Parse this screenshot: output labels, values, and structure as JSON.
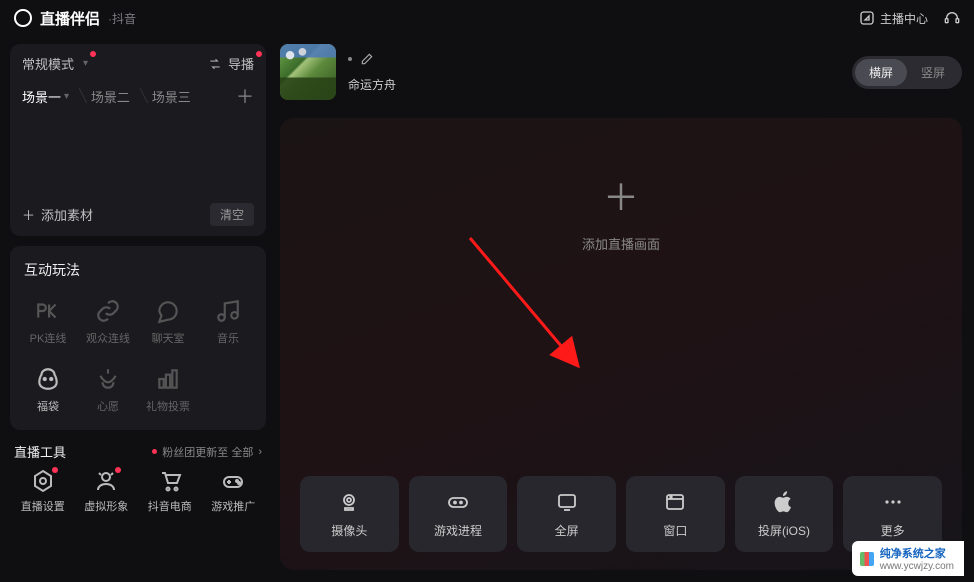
{
  "header": {
    "app_title": "直播伴侣",
    "sub_title": "·抖音",
    "host_center": "主播中心"
  },
  "sidebar": {
    "mode_label": "常规模式",
    "director_label": "导播",
    "scenes": [
      "场景一",
      "场景二",
      "场景三"
    ],
    "add_material": "添加素材",
    "clear": "清空",
    "interact_title": "互动玩法",
    "interact_items": [
      {
        "name": "pk",
        "label": "PK连线"
      },
      {
        "name": "audience",
        "label": "观众连线"
      },
      {
        "name": "chat",
        "label": "聊天室"
      },
      {
        "name": "music",
        "label": "音乐"
      },
      {
        "name": "lucky",
        "label": "福袋"
      },
      {
        "name": "wish",
        "label": "心愿"
      },
      {
        "name": "giftvote",
        "label": "礼物投票"
      }
    ],
    "tools_title": "直播工具",
    "tools_sub": "粉丝团更新至 全部",
    "tool_items": [
      {
        "name": "settings",
        "label": "直播设置",
        "dot": true
      },
      {
        "name": "avatar",
        "label": "虚拟形象",
        "dot": true
      },
      {
        "name": "ecom",
        "label": "抖音电商",
        "dot": false
      },
      {
        "name": "gamepromo",
        "label": "游戏推广",
        "dot": false
      }
    ]
  },
  "content": {
    "stream_title": "命运方舟",
    "orient_h": "横屏",
    "orient_v": "竖屏",
    "add_canvas": "添加直播画面",
    "sources": [
      {
        "name": "camera",
        "label": "摄像头"
      },
      {
        "name": "game",
        "label": "游戏进程"
      },
      {
        "name": "fullscreen",
        "label": "全屏"
      },
      {
        "name": "window",
        "label": "窗口"
      },
      {
        "name": "ios",
        "label": "投屏(iOS)"
      },
      {
        "name": "more",
        "label": "更多"
      }
    ]
  },
  "watermark": {
    "line1": "纯净系统之家",
    "line2": "www.ycwjzy.com"
  }
}
